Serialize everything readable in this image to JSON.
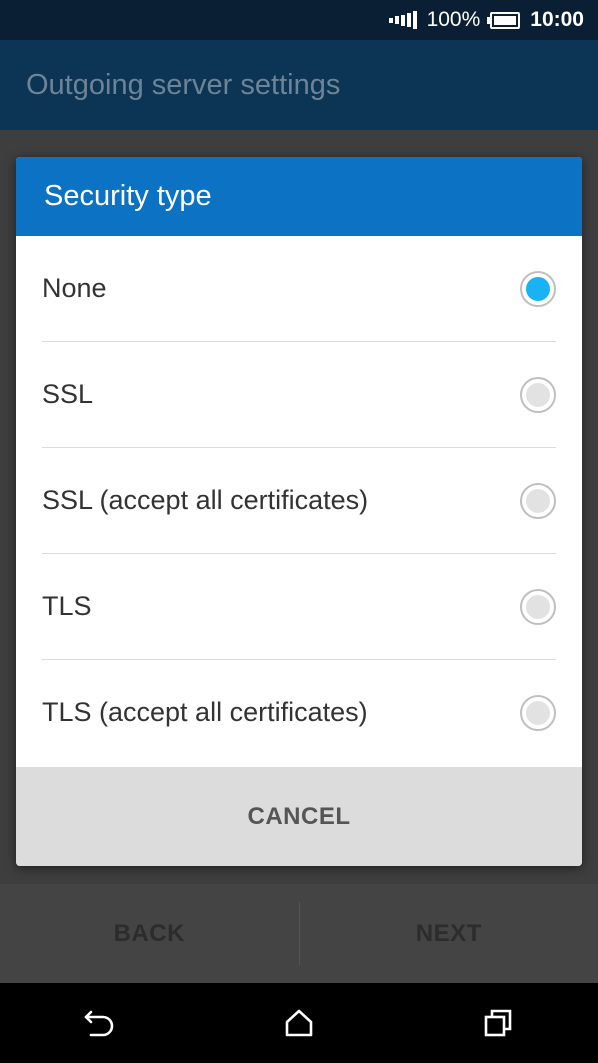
{
  "status_bar": {
    "battery_percent": "100%",
    "time": "10:00",
    "signal_level": 5
  },
  "app_bar": {
    "title": "Outgoing server settings"
  },
  "bottom_buttons": {
    "back_label": "BACK",
    "next_label": "NEXT"
  },
  "dialog": {
    "title": "Security type",
    "options": [
      {
        "label": "None",
        "selected": true
      },
      {
        "label": "SSL",
        "selected": false
      },
      {
        "label": "SSL (accept all certificates)",
        "selected": false
      },
      {
        "label": "TLS",
        "selected": false
      },
      {
        "label": "TLS (accept all certificates)",
        "selected": false
      }
    ],
    "cancel_label": "CANCEL"
  },
  "colors": {
    "accent": "#0b72c4",
    "selected_radio": "#19b2f5"
  },
  "icons": {
    "back": "back-arrow-icon",
    "home": "home-icon",
    "recents": "recents-icon"
  }
}
